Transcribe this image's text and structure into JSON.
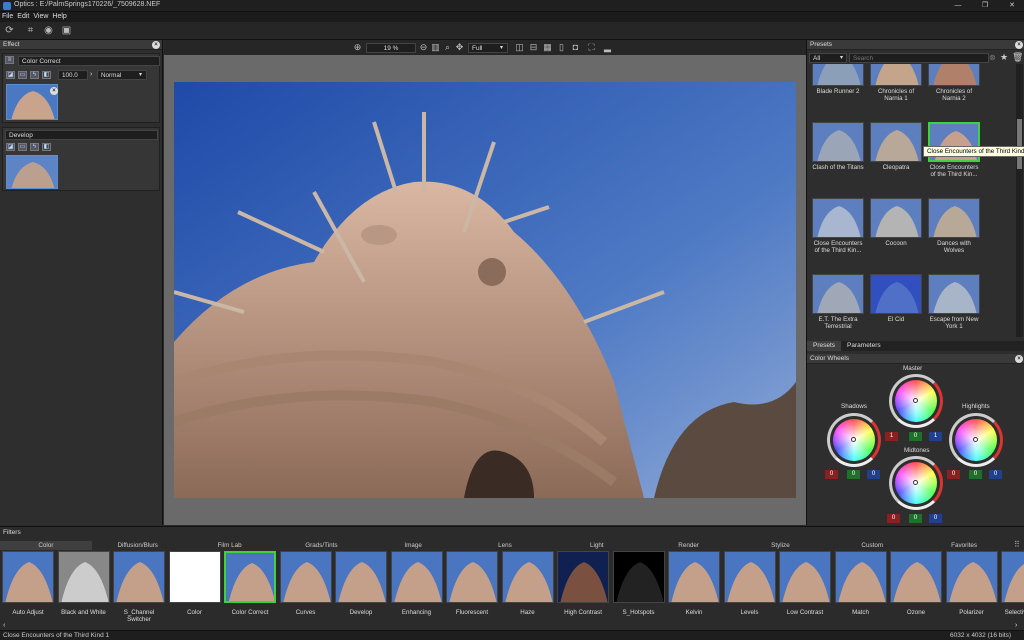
{
  "window": {
    "title": "Optics : E:/PalmSprings170226/_7509628.NEF"
  },
  "menu": [
    "File",
    "Edit",
    "View",
    "Help"
  ],
  "left_panel": {
    "title": "Effect",
    "layers": [
      {
        "name": "Color Correct",
        "opacity": "100.0",
        "blend": "Normal"
      },
      {
        "name": "Develop"
      }
    ]
  },
  "viewbar": {
    "zoom": "19 %",
    "view_mode": "Full"
  },
  "presets_panel": {
    "title": "Presets",
    "filter": "All",
    "search_placeholder": "Search",
    "items": [
      "Blade Runner 2",
      "Chronicles of Narnia 1",
      "Chronicles of Narnia 2",
      "Clash of the Titans",
      "Cleopatra",
      "Close Encounters of the Third Kin...",
      "Close Encounters of the Third Kin...",
      "Cocoon",
      "Dances with Wolves",
      "E.T. The Extra Terrestrial",
      "El Cid",
      "Escape from New York 1"
    ],
    "tooltip": "Close Encounters of the Third Kind 1",
    "tabs": [
      "Presets",
      "Parameters"
    ]
  },
  "color_wheels": {
    "title": "Color Wheels",
    "master": {
      "label": "Master",
      "values": [
        "1",
        "0",
        "1"
      ]
    },
    "shadows": {
      "label": "Shadows",
      "values": [
        "0",
        "0",
        "0"
      ]
    },
    "highlights": {
      "label": "Highlights",
      "values": [
        "0",
        "0",
        "0"
      ]
    },
    "midtones": {
      "label": "Midtones",
      "values": [
        "0",
        "0",
        "0"
      ]
    }
  },
  "filters_panel": {
    "title": "Filters",
    "categories": [
      "Color",
      "Diffusion/Blurs",
      "Film Lab",
      "Grads/Tints",
      "Image",
      "Lens",
      "Light",
      "Render",
      "Stylize",
      "Custom",
      "Favorites"
    ],
    "items": [
      "Auto Adjust",
      "Black and White",
      "S_Channel Switcher",
      "Color",
      "Color Correct",
      "Curves",
      "Develop",
      "Enhancing",
      "Fluorescent",
      "Haze",
      "High Contrast",
      "S_Hotspots",
      "Kelvin",
      "Levels",
      "Low Contrast",
      "Match",
      "Ozone",
      "Polarizer",
      "Selective Colo..."
    ]
  },
  "status": {
    "left": "Close Encounters of the Third Kind 1",
    "right": "6032 x 4032 (16 bits)"
  }
}
